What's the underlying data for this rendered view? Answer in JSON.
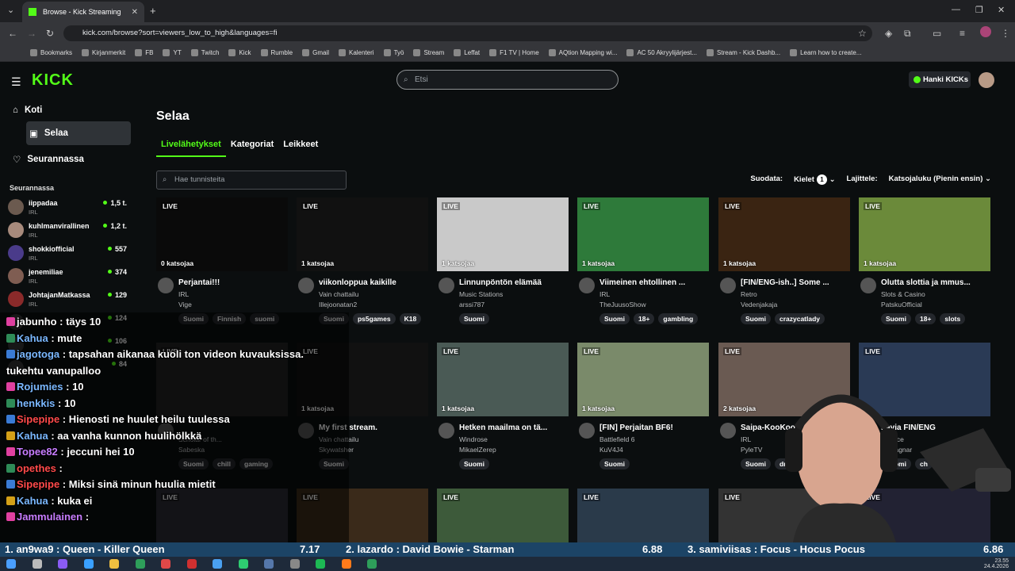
{
  "browser": {
    "tab_title": "Browse - Kick Streaming",
    "url": "kick.com/browse?sort=viewers_low_to_high&languages=fi",
    "bookmarks": [
      "Bookmarks",
      "Kirjanmerkit",
      "FB",
      "YT",
      "Twitch",
      "Kick",
      "Rumble",
      "Gmail",
      "Kalenteri",
      "Työ",
      "Stream",
      "Leffat",
      "F1 TV | Home",
      "AQtion Mapping wi...",
      "AC 50 Akryylijärjest...",
      "Stream - Kick Dashb...",
      "Learn how to create..."
    ]
  },
  "header": {
    "logo": "KICK",
    "search_placeholder": "Etsi",
    "kicks_button": "Hanki KICKs"
  },
  "sidebar": {
    "nav": [
      {
        "label": "Koti",
        "icon": "home-icon"
      },
      {
        "label": "Selaa",
        "icon": "browse-icon"
      },
      {
        "label": "Seurannassa",
        "icon": "heart-icon"
      }
    ],
    "following_header": "Seurannassa",
    "following": [
      {
        "name": "iippadaa",
        "category": "IRL",
        "viewers": "1,5 t.",
        "color": "#6b5a4f"
      },
      {
        "name": "kuhlmanvirallinen",
        "category": "IRL",
        "viewers": "1,2 t.",
        "color": "#a78a7c"
      },
      {
        "name": "shokkiofficial",
        "category": "IRL",
        "viewers": "557",
        "color": "#4a3b8a"
      },
      {
        "name": "jenemiliae",
        "category": "IRL",
        "viewers": "374",
        "color": "#7f5d52"
      },
      {
        "name": "JohtajanMatkassa",
        "category": "IRL",
        "viewers": "129",
        "color": "#8a2a2a"
      },
      {
        "name": "",
        "category": "",
        "viewers": "124",
        "color": "#333"
      },
      {
        "name": "",
        "category": "",
        "viewers": "106",
        "color": "#333"
      },
      {
        "name": "",
        "category": "",
        "viewers": "84",
        "color": "#333"
      }
    ]
  },
  "main": {
    "title": "Selaa",
    "tabs": [
      "Livelähetykset",
      "Kategoriat",
      "Leikkeet"
    ],
    "tag_search_placeholder": "Hae tunnisteita",
    "filter_label": "Suodata:",
    "languages_label": "Kielet",
    "languages_count": "1",
    "sort_label": "Lajittele:",
    "sort_value": "Katsojaluku (Pienin ensin)",
    "live_label": "LIVE",
    "row1": [
      {
        "viewers": "0 katsojaa",
        "title": "Perjantai!!!",
        "category": "IRL",
        "streamer": "Vige",
        "tags": [
          "Suomi",
          "Finnish",
          "suomi"
        ],
        "thumb": "#0a0a0a"
      },
      {
        "viewers": "1 katsojaa",
        "title": "viikonloppua kaikille",
        "category": "Vain chattailu",
        "streamer": "Illejoonatan2",
        "tags": [
          "Suomi",
          "ps5games",
          "K18"
        ],
        "thumb": "#111"
      },
      {
        "viewers": "1 katsojaa",
        "title": "Linnunpöntön elämää",
        "category": "Music Stations",
        "streamer": "arssi787",
        "tags": [
          "Suomi"
        ],
        "thumb": "#c9c9c9"
      },
      {
        "viewers": "1 katsojaa",
        "title": "Viimeinen ehtollinen ...",
        "category": "IRL",
        "streamer": "TheJuusoShow",
        "tags": [
          "Suomi",
          "18+",
          "gambling"
        ],
        "thumb": "#2e7a3a"
      },
      {
        "viewers": "1 katsojaa",
        "title": "[FIN/ENG-ish..] Some ...",
        "category": "Retro",
        "streamer": "Vedenjakaja",
        "tags": [
          "Suomi",
          "crazycatlady"
        ],
        "thumb": "#3a2412"
      },
      {
        "viewers": "1 katsojaa",
        "title": "Olutta slottia ja mmus...",
        "category": "Slots & Casino",
        "streamer": "PatskuOfficial",
        "tags": [
          "Suomi",
          "18+",
          "slots"
        ],
        "thumb": "#6b8a3a"
      }
    ],
    "row2": [
      {
        "viewers": "",
        "title": "",
        "category": "Scholar of th...",
        "streamer": "Sabeska",
        "tags": [
          "Suomi",
          "chill",
          "gaming"
        ],
        "thumb": "#222"
      },
      {
        "viewers": "1 katsojaa",
        "title": "My first stream.",
        "category": "Vain chattailu",
        "streamer": "Skywatsher",
        "tags": [
          "Suomi"
        ],
        "thumb": "#111"
      },
      {
        "viewers": "1 katsojaa",
        "title": "Hetken maailma on tä...",
        "category": "Windrose",
        "streamer": "MikaelZerep",
        "tags": [
          "Suomi"
        ],
        "thumb": "#4a5a55"
      },
      {
        "viewers": "1 katsojaa",
        "title": "[FIN] Perjaitan BF6!",
        "category": "Battlefield 6",
        "streamer": "KuV4J4",
        "tags": [
          "Suomi"
        ],
        "thumb": "#7a8a6a"
      },
      {
        "viewers": "2 katsojaa",
        "title": "Saipa-KooKoo e",
        "category": "IRL",
        "streamer": "PyleTV",
        "tags": [
          "Suomi",
          "drinking"
        ],
        "thumb": "#6a5a52"
      },
      {
        "viewers": "",
        "title": "havia FIN/ENG",
        "category": "a Force",
        "streamer": "staRagnar",
        "tags": [
          "Suomi",
          "ch"
        ],
        "thumb": "#2a3a55"
      }
    ]
  },
  "chat": [
    {
      "user": "jabunho",
      "text": ": täys 10",
      "color": "#ffffff"
    },
    {
      "user": "Kahua",
      "text": ": mute",
      "color": "#7ab8ff"
    },
    {
      "user": "jagotoga",
      "text": ": tapsahan aikanaa kuoli ton videon kuvauksissa.",
      "color": "#7ab8ff"
    },
    {
      "user": "",
      "text": "tukehtu vanupalloo",
      "color": "#ffffff"
    },
    {
      "user": "Rojumies",
      "text": ": 10",
      "color": "#7ab8ff"
    },
    {
      "user": "henkkis",
      "text": ": 10",
      "color": "#7ab8ff"
    },
    {
      "user": "Sipepipe",
      "text": ": Hienosti ne huulet heilu tuulessa",
      "color": "#ff4a4a"
    },
    {
      "user": "Kahua",
      "text": ": aa vanha kunnon huulihölkkä",
      "color": "#7ab8ff"
    },
    {
      "user": "Topee82",
      "text": ": jeccuni hei 10",
      "color": "#c77dff"
    },
    {
      "user": "opethes",
      "text": ":",
      "color": "#ff4a4a"
    },
    {
      "user": "Sipepipe",
      "text": ": Miksi sinä minun huulia mietit",
      "color": "#ff4a4a"
    },
    {
      "user": "Kahua",
      "text": ": kuka ei",
      "color": "#7ab8ff"
    },
    {
      "user": "Jammulainen",
      "text": ":",
      "color": "#c77dff"
    }
  ],
  "ticker": [
    {
      "rank": "1.",
      "user": "an9wa9",
      "song": ": Queen - Killer Queen",
      "score": "7.17"
    },
    {
      "rank": "2.",
      "user": "lazardo",
      "song": ": David Bowie - Starman",
      "score": "6.88"
    },
    {
      "rank": "3.",
      "user": "samiviisas",
      "song": ": Focus - Hocus Pocus",
      "score": "6.86"
    }
  ],
  "clock": {
    "time": "23.55",
    "date": "24.4.2026"
  }
}
